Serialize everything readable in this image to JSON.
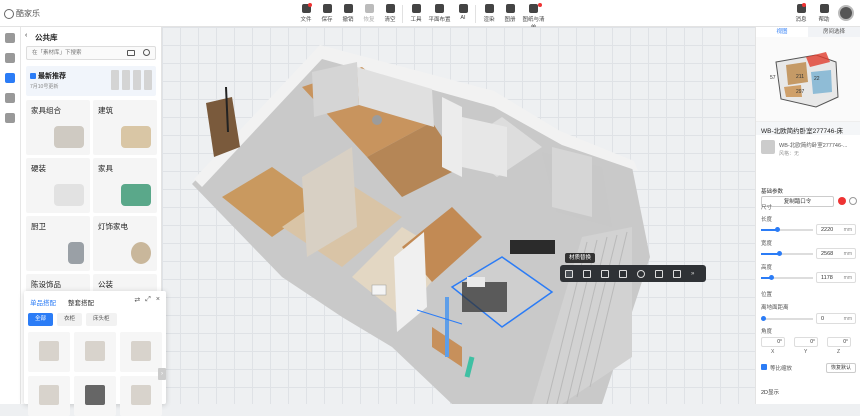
{
  "app": {
    "logo_text": "酷家乐"
  },
  "toolbar": {
    "items": [
      {
        "label": "文件",
        "dot": true,
        "dim": false
      },
      {
        "label": "保存",
        "dot": false,
        "dim": false
      },
      {
        "label": "撤销",
        "dot": false,
        "dim": false
      },
      {
        "label": "恢复",
        "dot": false,
        "dim": true
      },
      {
        "label": "清空",
        "dot": false,
        "dim": false
      },
      {
        "label": "工具",
        "dot": false,
        "dim": false
      },
      {
        "label": "平面布置",
        "dot": false,
        "dim": false
      },
      {
        "label": "AI",
        "dot": false,
        "dim": false
      },
      {
        "label": "渲染",
        "dot": false,
        "dim": false
      },
      {
        "label": "图册",
        "dot": false,
        "dim": false
      },
      {
        "label": "图纸与清单",
        "dot": true,
        "dim": false
      }
    ],
    "right": [
      {
        "label": "消息",
        "badge": "4"
      },
      {
        "label": "帮助",
        "badge": ""
      }
    ]
  },
  "left_panel": {
    "title": "公共库",
    "search_placeholder": "在「素材库」下搜索",
    "banner": {
      "title": "最新推荐",
      "date": "7月10号更新"
    },
    "categories": [
      "家具组合",
      "建筑",
      "硬装",
      "家具",
      "厨卫",
      "灯饰家电",
      "陈设饰品",
      "公装"
    ]
  },
  "popup": {
    "tabs": [
      "单品搭配",
      "整套搭配"
    ],
    "chips": [
      "全部",
      "衣柜",
      "床头柜"
    ]
  },
  "canvas": {
    "selection_label": "材质替换"
  },
  "right_panel": {
    "tabs": [
      "视图",
      "房间选择"
    ],
    "minimap_labels": [
      "57",
      "211",
      "22",
      "297"
    ],
    "product_title": "WB-北欧简约卧室277746-床",
    "product_name": "WB-北欧简约卧室277746-...",
    "product_style": "风格：无",
    "replace_label": "复制踏口令",
    "basic_params": "基础参数",
    "size_label": "尺寸",
    "dims": [
      {
        "label": "长度",
        "value": "2220",
        "unit": "mm",
        "fraction": 0.3
      },
      {
        "label": "宽度",
        "value": "2568",
        "unit": "mm",
        "fraction": 0.35
      },
      {
        "label": "高度",
        "value": "1178",
        "unit": "mm",
        "fraction": 0.2
      }
    ],
    "position_label": "位置",
    "ground_label": "离地面距离",
    "ground_value": "0",
    "ground_unit": "mm",
    "angle_label": "角度",
    "angles": [
      {
        "axis": "X",
        "value": "0°"
      },
      {
        "axis": "Y",
        "value": "0°"
      },
      {
        "axis": "Z",
        "value": "0°"
      }
    ],
    "lock_label": "等比缩放",
    "reset_label": "恢复默认",
    "section_2d": "2D显示"
  }
}
